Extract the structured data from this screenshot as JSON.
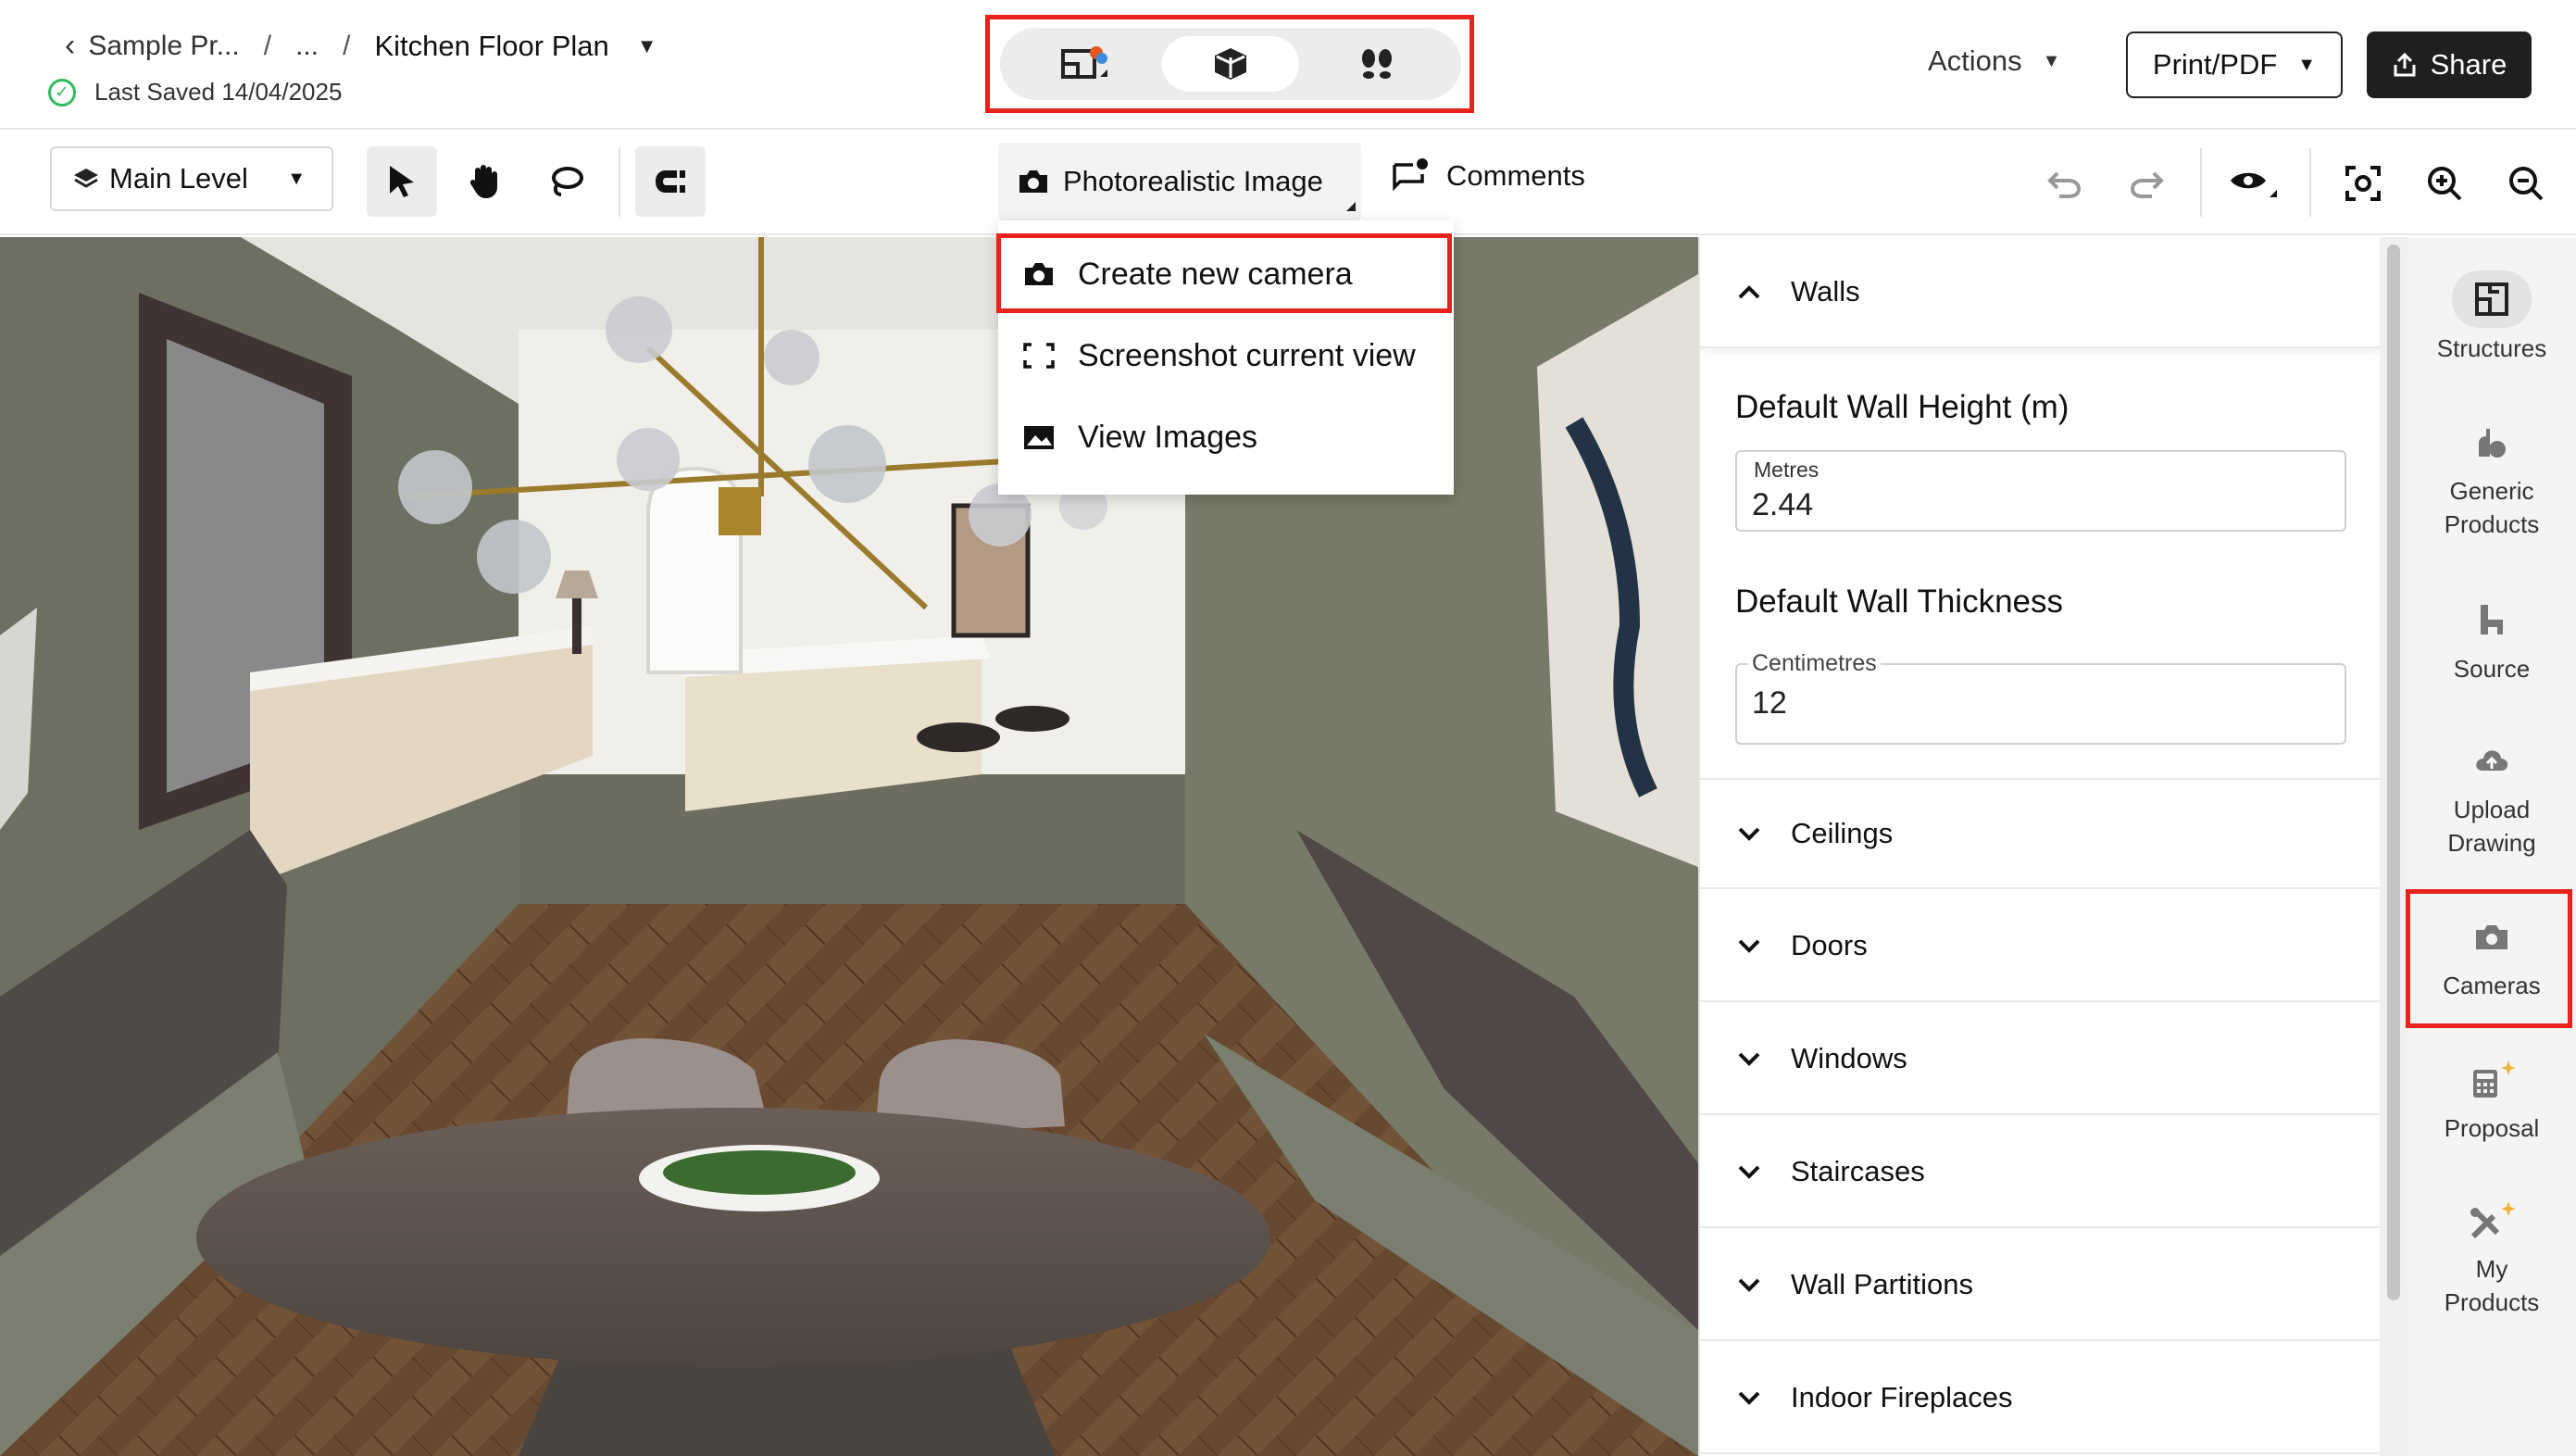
{
  "header": {
    "breadcrumb_root": "Sample Pr...",
    "breadcrumb_sep1": "/",
    "breadcrumb_ellipsis": "...",
    "breadcrumb_sep2": "/",
    "document_title": "Kitchen Floor Plan",
    "last_saved": "Last Saved 14/04/2025",
    "actions_label": "Actions",
    "print_label": "Print/PDF",
    "share_label": "Share",
    "view_modes": [
      "floor-plan-icon",
      "3d-box-icon",
      "footsteps-icon"
    ],
    "active_view_mode": "3d-box-icon"
  },
  "toolbar": {
    "level_label": "Main Level",
    "photo_label": "Photorealistic Image",
    "comments_label": "Comments"
  },
  "dropdown": {
    "items": [
      {
        "label": "Create new camera",
        "icon": "camera-icon"
      },
      {
        "label": "Screenshot current view",
        "icon": "screenshot-frame-icon"
      },
      {
        "label": "View Images",
        "icon": "image-icon"
      }
    ]
  },
  "panel": {
    "walls_label": "Walls",
    "wall_height_title": "Default Wall Height (m)",
    "wall_height_unit": "Metres",
    "wall_height_value": "2.44",
    "wall_thickness_title": "Default Wall Thickness",
    "wall_thickness_unit": "Centimetres",
    "wall_thickness_value": "12",
    "sections": [
      "Ceilings",
      "Doors",
      "Windows",
      "Staircases",
      "Wall Partitions",
      "Indoor Fireplaces"
    ]
  },
  "rail": {
    "items": [
      {
        "label1": "Structures",
        "label2": ""
      },
      {
        "label1": "Generic",
        "label2": "Products"
      },
      {
        "label1": "Source",
        "label2": ""
      },
      {
        "label1": "Upload",
        "label2": "Drawing"
      },
      {
        "label1": "Cameras",
        "label2": ""
      },
      {
        "label1": "Proposal",
        "label2": ""
      },
      {
        "label1": "My",
        "label2": "Products"
      }
    ]
  },
  "colors": {
    "highlight": "#e8231e",
    "saved_green": "#2ebd59",
    "share_bg": "#1f1f1f",
    "sparkle": "#f2b233"
  }
}
